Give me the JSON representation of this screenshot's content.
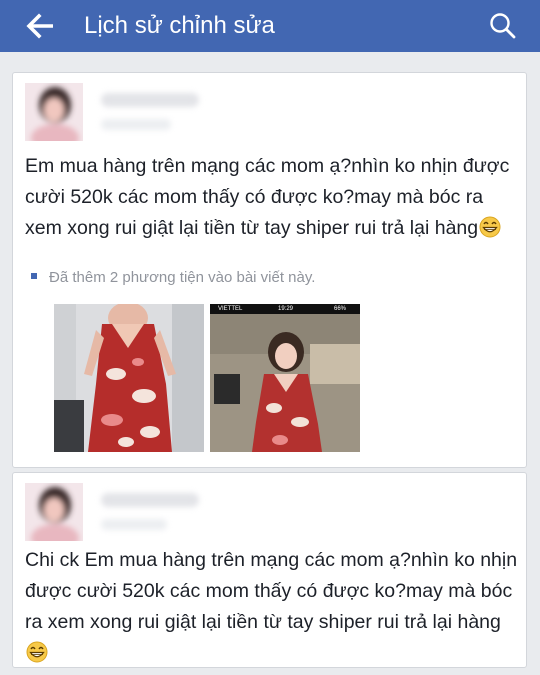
{
  "header": {
    "title": "Lịch sử chỉnh sửa",
    "back_icon": "arrow-left-icon",
    "search_icon": "search-icon",
    "bar_color": "#4267b2"
  },
  "revisions": [
    {
      "body": "Em mua hàng trên mạng các mom ạ?nhìn ko nhịn được cười 520k các mom thấy có được ko?may mà bóc ra xem xong rui giật lại tiền từ tay shiper rui trả lại hàng",
      "emoji": "grinning-face-icon",
      "media_note": "Đã thêm 2 phương tiện vào bài viết này.",
      "photo_status": {
        "carrier": "VIETTEL",
        "time": "19:29",
        "battery": "66%"
      }
    },
    {
      "body": "Chi ck Em mua hàng trên mạng các mom ạ?nhìn ko nhịn được cười 520k các mom thấy có được ko?may mà bóc ra xem xong rui giật lại tiền từ tay shiper rui trả lại hàng",
      "emoji": "grinning-face-icon"
    }
  ]
}
